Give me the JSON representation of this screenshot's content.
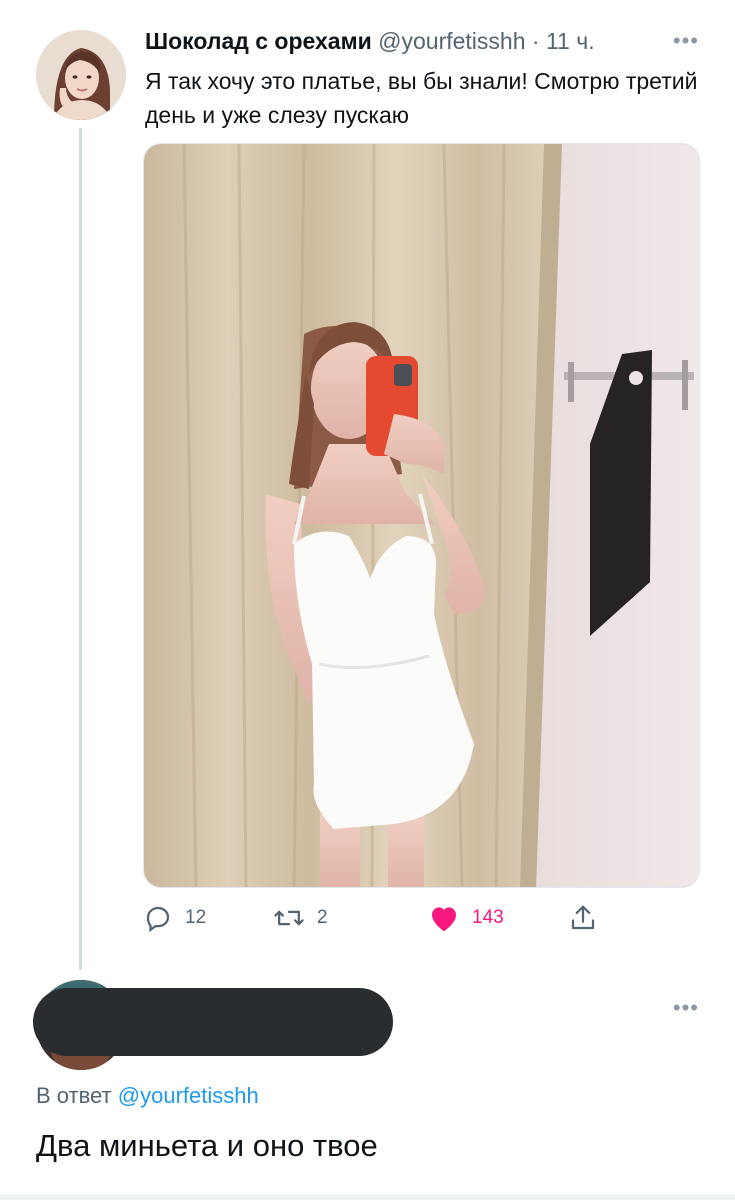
{
  "tweet": {
    "author_name": "Шоколад с орехами",
    "handle": "@yourfetisshh",
    "separator": "·",
    "time": "11 ч.",
    "more_icon": "more-dots-icon",
    "text": "Я так хочу это платье, вы бы знали! Смотрю третий день и уже слезу пускаю",
    "actions": {
      "reply_count": "12",
      "retweet_count": "2",
      "like_count": "143"
    },
    "colors": {
      "like": "#f91880",
      "muted": "#536471",
      "link": "#1d9bf0"
    }
  },
  "reply": {
    "reply_to_prefix": "В ответ",
    "reply_to_handle": "@yourfetisshh",
    "text": "Два миньета и оно твое"
  }
}
